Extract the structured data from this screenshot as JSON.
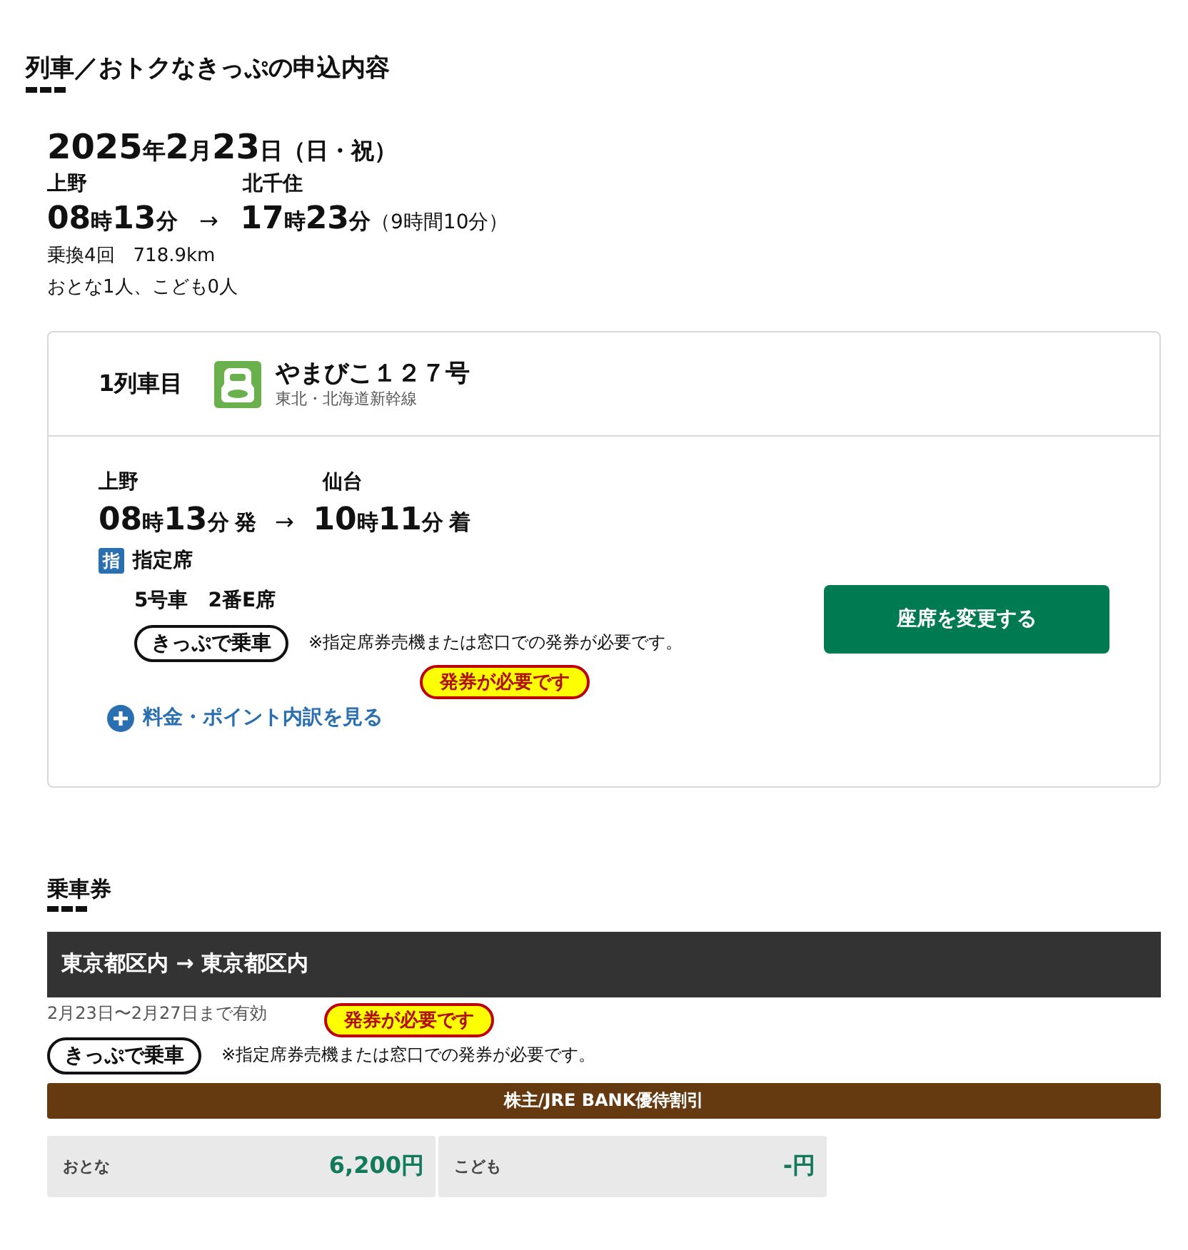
{
  "section_title": "列車／おトクなきっぷの申込内容",
  "journey": {
    "date": [
      "2025",
      "年",
      "2",
      "月",
      "23",
      "日"
    ],
    "date_note": "（日・祝）",
    "from": "上野",
    "to": "北千住",
    "depart": [
      "08",
      "時",
      "13",
      "分"
    ],
    "arrow": "→",
    "arrive": [
      "17",
      "時",
      "23",
      "分"
    ],
    "duration": "（9時間10分）",
    "transfers": "乗換4回　718.9km",
    "passengers": "おとな1人、こども0人"
  },
  "trains": [
    {
      "index_label": "1列車目",
      "name": "やまびこ１２７号",
      "line": "東北・北海道新幹線",
      "from": "上野",
      "to": "仙台",
      "depart": [
        "08",
        "時",
        "13",
        "分"
      ],
      "depart_suffix": "発",
      "arrow": "→",
      "arrive": [
        "10",
        "時",
        "11",
        "分"
      ],
      "arrive_suffix": "着",
      "seat_badge": "指",
      "seat_type": "指定席",
      "seat": "5号車　2番E席",
      "ticket_tag": "きっぷで乗車",
      "note": "※指定席券売機または窓口での発券が必要です。",
      "issue_badge": "発券が必要です",
      "fare_link": "料金・ポイント内訳を見る",
      "change_button": "座席を変更する"
    }
  ],
  "tickets_title": "乗車券",
  "ticket": {
    "route": "東京都区内 → 東京都区内",
    "validity": "2月23日〜2月27日まで有効",
    "issue_badge": "発券が必要です",
    "ticket_tag": "きっぷで乗車",
    "note": "※指定席券売機または窓口での発券が必要です。",
    "discount": "株主/JRE BANK優待割引",
    "fares": [
      {
        "label": "おとな",
        "amount": "6,200円"
      },
      {
        "label": "こども",
        "amount": "-円"
      }
    ]
  }
}
